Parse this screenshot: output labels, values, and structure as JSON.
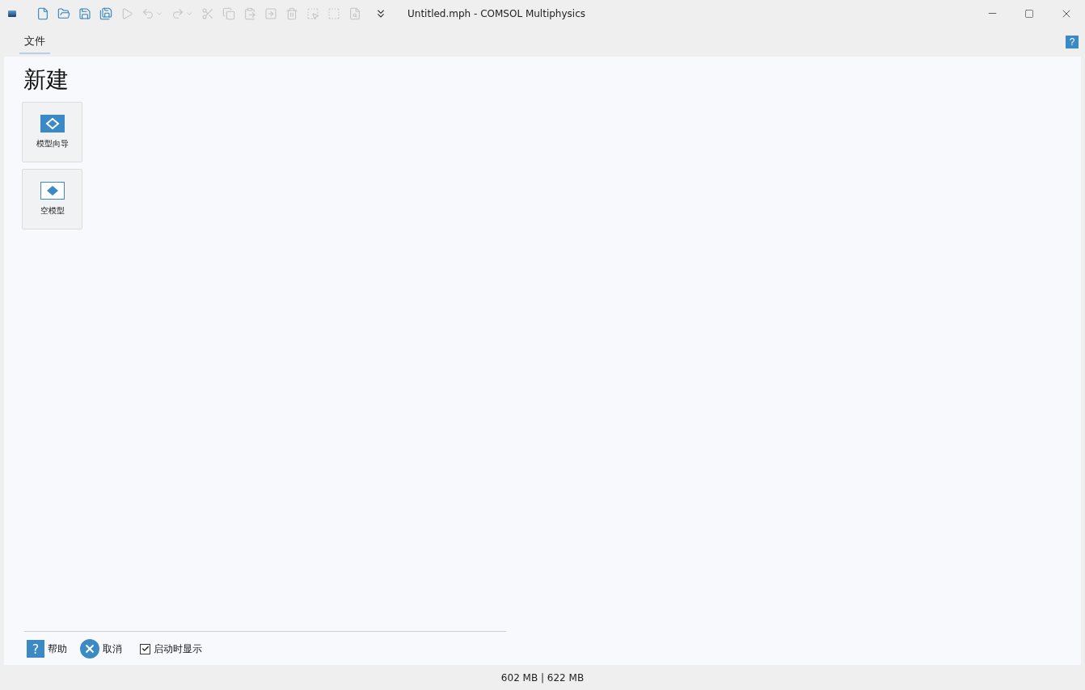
{
  "window": {
    "title": "Untitled.mph - COMSOL Multiphysics"
  },
  "toolbar": [
    {
      "kind": "new",
      "disabled": false
    },
    {
      "kind": "open",
      "disabled": false
    },
    {
      "kind": "save",
      "disabled": false
    },
    {
      "kind": "save-as",
      "disabled": false
    },
    {
      "kind": "run",
      "disabled": true
    },
    {
      "kind": "undo",
      "disabled": true
    },
    {
      "kind": "redo",
      "disabled": true
    },
    {
      "kind": "cut",
      "disabled": true
    },
    {
      "kind": "copy",
      "disabled": true
    },
    {
      "kind": "paste",
      "disabled": true
    },
    {
      "kind": "duplicate",
      "disabled": true
    },
    {
      "kind": "delete",
      "disabled": true
    },
    {
      "kind": "select",
      "disabled": true
    },
    {
      "kind": "deselect",
      "disabled": true
    },
    {
      "kind": "find",
      "disabled": true
    }
  ],
  "tabs": [
    {
      "label": "文件",
      "selected": true
    }
  ],
  "help_button": {
    "label": "?"
  },
  "page": {
    "heading": "新建",
    "tiles": [
      {
        "kind": "wizard",
        "label": "模型向导"
      },
      {
        "kind": "blank",
        "label": "空模型"
      }
    ]
  },
  "footer": {
    "help": {
      "icon_glyph": "?",
      "label": "帮助"
    },
    "cancel": {
      "label": "取消"
    },
    "show_on_startup": {
      "label": "启动时显示",
      "checked": true
    }
  },
  "status_bar": {
    "memory": "602 MB | 622 MB"
  }
}
